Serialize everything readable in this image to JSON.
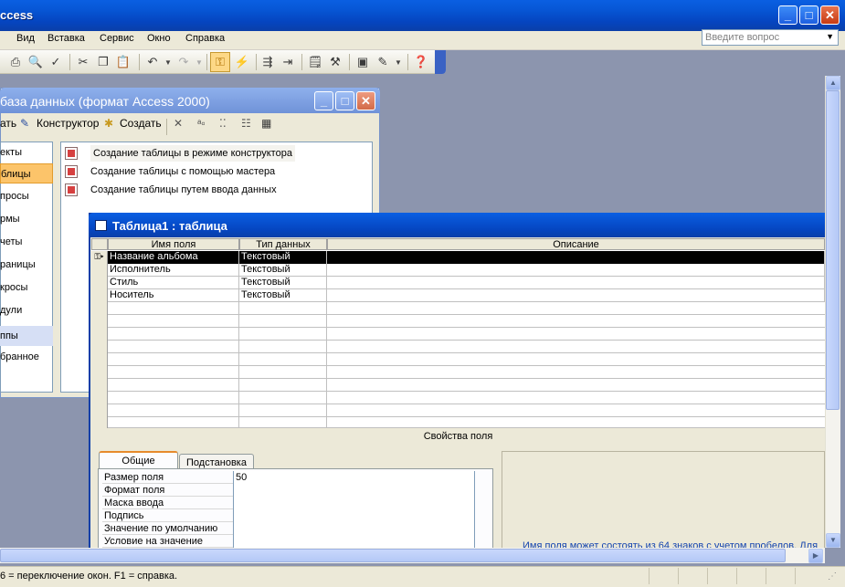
{
  "app": {
    "title": "ccess",
    "window_buttons": {
      "minimize": "_",
      "maximize": "□",
      "close": "✕"
    }
  },
  "menu": {
    "items": [
      "Вид",
      "Вставка",
      "Сервис",
      "Окно",
      "Справка"
    ],
    "ask_placeholder": "Введите вопрос"
  },
  "db_window": {
    "title": "база данных (формат Access 2000)",
    "toolbar": {
      "open": "ать",
      "designer": "Конструктор",
      "create": "Создать"
    },
    "left_items": [
      "екты",
      "блицы",
      "просы",
      "рмы",
      "четы",
      "раницы",
      "кросы",
      "дули",
      "ппы",
      "бранное"
    ],
    "list_items": [
      "Создание таблицы в режиме конструктора",
      "Создание таблицы с помощью мастера",
      "Создание таблицы путем ввода данных"
    ]
  },
  "table_window": {
    "title": "Таблица1 : таблица",
    "headers": {
      "name": "Имя поля",
      "type": "Тип данных",
      "desc": "Описание"
    },
    "rows": [
      {
        "name": "Название альбома",
        "type": "Текстовый",
        "desc": ""
      },
      {
        "name": "Исполнитель",
        "type": "Текстовый",
        "desc": ""
      },
      {
        "name": "Стиль",
        "type": "Текстовый",
        "desc": ""
      },
      {
        "name": "Носитель",
        "type": "Текстовый",
        "desc": ""
      }
    ],
    "properties_title": "Свойства поля",
    "tabs": {
      "general": "Общие",
      "lookup": "Подстановка"
    },
    "properties": [
      {
        "label": "Размер поля",
        "value": "50"
      },
      {
        "label": "Формат поля",
        "value": ""
      },
      {
        "label": "Маска ввода",
        "value": ""
      },
      {
        "label": "Подпись",
        "value": ""
      },
      {
        "label": "Значение по умолчанию",
        "value": ""
      },
      {
        "label": "Условие на значение",
        "value": ""
      }
    ],
    "hint": "Имя поля может состоять из 64 знаков с учетом пробелов. Для"
  },
  "status": {
    "text": "6 = переключение окон.  F1 = справка."
  }
}
